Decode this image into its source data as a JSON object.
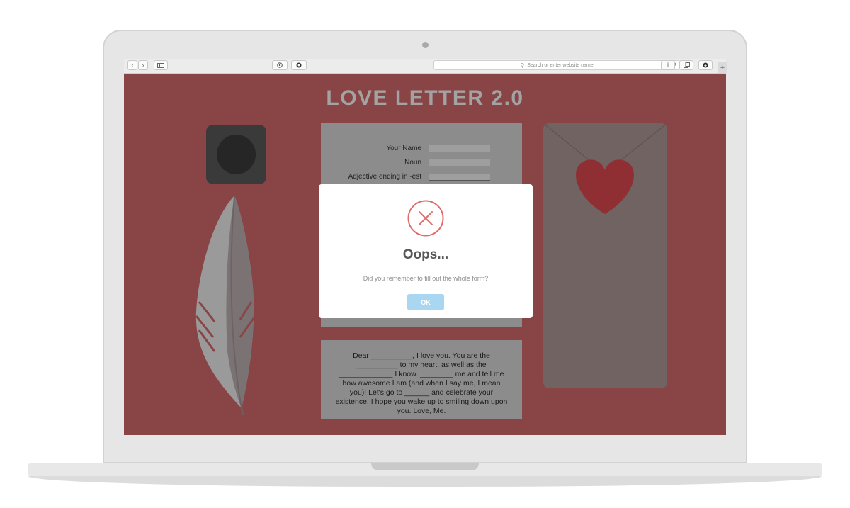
{
  "browser": {
    "address_placeholder": "Search or enter website name",
    "back_icon": "chevron-left-icon",
    "forward_icon": "chevron-right-icon"
  },
  "page": {
    "title": "LOVE LETTER 2.0",
    "background_color": "#894546"
  },
  "form": {
    "fields": [
      {
        "label": "Your Name"
      },
      {
        "label": "Noun"
      },
      {
        "label": "Adjective ending in -est"
      }
    ]
  },
  "letter": {
    "text": "Dear __________, I love you. You are the __________ to my heart, as well as the _____________ I know. ________ me and tell me how awesome I am (and when I say me, I mean you)! Let's go to ______ and celebrate your existence. I hope you wake up to smiling down upon you. Love, Me."
  },
  "modal": {
    "icon": "error-x-icon",
    "heading": "Oops...",
    "message": "Did you remember to fill out the whole form?",
    "ok_label": "OK",
    "accent_color": "#e06b6b",
    "button_color": "#a9d6f0"
  }
}
